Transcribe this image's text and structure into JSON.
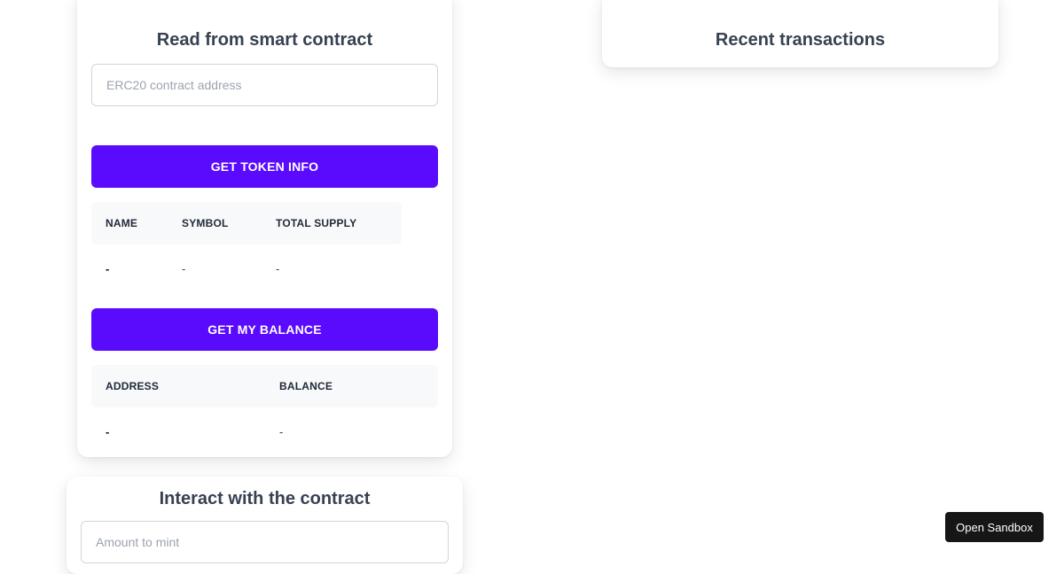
{
  "read_card": {
    "title": "Read from smart contract",
    "address_input": {
      "placeholder": "ERC20 contract address",
      "value": ""
    },
    "get_token_info_label": "GET TOKEN INFO",
    "token_table": {
      "headers": [
        "NAME",
        "SYMBOL",
        "TOTAL SUPPLY"
      ],
      "row": [
        "-",
        "-",
        "-"
      ]
    },
    "get_balance_label": "GET MY BALANCE",
    "balance_table": {
      "headers": [
        "ADDRESS",
        "BALANCE"
      ],
      "row": [
        "-",
        "-"
      ]
    }
  },
  "transactions_card": {
    "title": "Recent transactions"
  },
  "interact_card": {
    "title": "Interact with the contract",
    "mint_input": {
      "placeholder": "Amount to mint",
      "value": ""
    }
  },
  "sandbox_button": {
    "label": "Open Sandbox"
  }
}
